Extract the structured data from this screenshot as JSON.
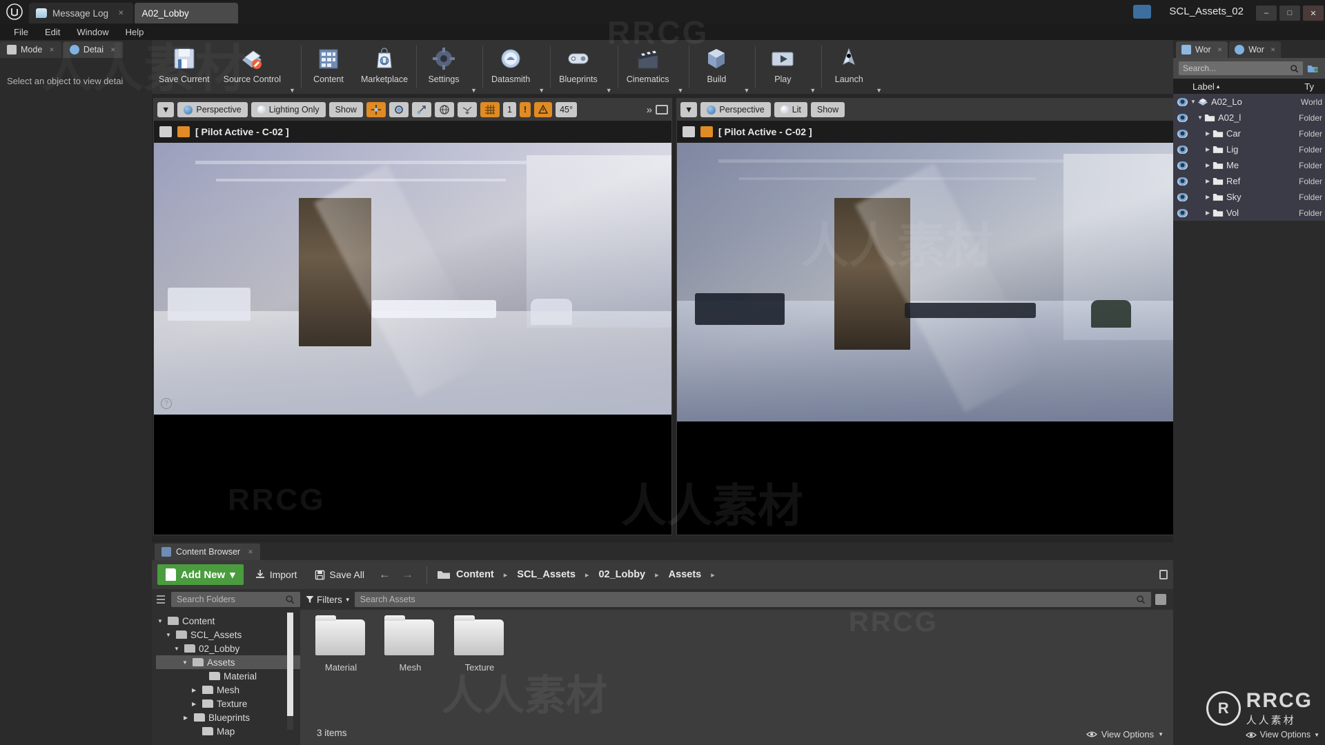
{
  "titlebar": {
    "logo_icon": "unreal-engine-logo",
    "tabs": [
      {
        "label": "Message Log",
        "icon": "message-log-icon",
        "active": false
      },
      {
        "label": "A02_Lobby",
        "icon": "level-icon",
        "active": true
      }
    ],
    "project_name": "SCL_Assets_02",
    "window_buttons": [
      "minimize",
      "maximize",
      "close"
    ],
    "minimize_glyph": "–",
    "maximize_glyph": "□",
    "close_glyph": "✕"
  },
  "menubar": {
    "items": [
      "File",
      "Edit",
      "Window",
      "Help"
    ]
  },
  "left_panel": {
    "tabs": [
      {
        "label": "Mode",
        "icon": "mode-hand-icon",
        "active": false
      },
      {
        "label": "Detai",
        "icon": "details-info-icon",
        "active": true
      }
    ],
    "empty_message": "Select an object to view detai"
  },
  "toolbar": {
    "items": [
      {
        "label": "Save Current",
        "icon": "save-floppy-icon",
        "has_caret": false
      },
      {
        "label": "Source Control",
        "icon": "source-control-icon",
        "has_caret": true
      },
      {
        "label": "Content",
        "icon": "content-browser-icon",
        "has_caret": false
      },
      {
        "label": "Marketplace",
        "icon": "marketplace-bag-icon",
        "has_caret": false
      },
      {
        "label": "Settings",
        "icon": "settings-gear-icon",
        "has_caret": true
      },
      {
        "label": "Datasmith",
        "icon": "datasmith-icon",
        "has_caret": true
      },
      {
        "label": "Blueprints",
        "icon": "blueprints-icon",
        "has_caret": true
      },
      {
        "label": "Cinematics",
        "icon": "cinematics-clapper-icon",
        "has_caret": true
      },
      {
        "label": "Build",
        "icon": "build-cube-icon",
        "has_caret": true
      },
      {
        "label": "Play",
        "icon": "play-icon",
        "has_caret": true
      },
      {
        "label": "Launch",
        "icon": "launch-rocket-icon",
        "has_caret": true
      }
    ]
  },
  "viewports": [
    {
      "name": "viewport-left",
      "camera_label": "Perspective",
      "view_mode": "Lighting Only",
      "show_label": "Show",
      "pilot_text": "[ Pilot Active - C-02 ]",
      "angle_snap": "45°",
      "transform_toggles": [
        "translate-gizmo-icon",
        "rotate-gizmo-icon",
        "scale-gizmo-icon"
      ],
      "coord_icon": "world-coordinate-icon",
      "surface_snap_icon": "surface-snap-icon",
      "grid_snap_icon": "grid-snap-icon",
      "grid_value": "1",
      "overflow_glyph": "»",
      "maximize_icon": "maximize-viewport-icon",
      "help_glyph": "?"
    },
    {
      "name": "viewport-right",
      "camera_label": "Perspective",
      "view_mode": "Lit",
      "show_label": "Show",
      "pilot_text": "[ Pilot Active - C-02 ]",
      "maximize_icon": "maximize-viewport-icon"
    }
  ],
  "content_browser": {
    "tab_label": "Content Browser",
    "tab_icon": "content-browser-icon",
    "add_new_label": "Add New",
    "add_new_caret": "▾",
    "import_label": "Import",
    "save_all_label": "Save All",
    "back_glyph": "←",
    "forward_glyph": "→",
    "breadcrumb": [
      "Content",
      "SCL_Assets",
      "02_Lobby",
      "Assets"
    ],
    "breadcrumb_sep": "▸",
    "folder_search_placeholder": "Search Folders",
    "filters_label": "Filters",
    "asset_search_placeholder": "Search Assets",
    "tree": [
      {
        "label": "Content",
        "depth": 0,
        "expanded": true,
        "selected": false
      },
      {
        "label": "SCL_Assets",
        "depth": 1,
        "expanded": true,
        "selected": false
      },
      {
        "label": "02_Lobby",
        "depth": 2,
        "expanded": true,
        "selected": false
      },
      {
        "label": "Assets",
        "depth": 3,
        "expanded": true,
        "selected": true
      },
      {
        "label": "Material",
        "depth": 4,
        "expanded": false,
        "selected": false
      },
      {
        "label": "Mesh",
        "depth": 4,
        "expanded": false,
        "selected": false
      },
      {
        "label": "Texture",
        "depth": 4,
        "expanded": false,
        "selected": false
      },
      {
        "label": "Blueprints",
        "depth": 3,
        "expanded": false,
        "selected": false
      },
      {
        "label": "Map",
        "depth": 3,
        "expanded": false,
        "selected": false
      }
    ],
    "assets": [
      {
        "name": "Material",
        "type": "folder"
      },
      {
        "name": "Mesh",
        "type": "folder"
      },
      {
        "name": "Texture",
        "type": "folder"
      }
    ],
    "item_count_text": "3 items",
    "view_options_label": "View Options",
    "view_options_icon": "eye-icon"
  },
  "right_panel": {
    "tabs": [
      {
        "label": "Wor",
        "icon": "world-outliner-icon",
        "active": true
      },
      {
        "label": "Wor",
        "icon": "world-settings-icon",
        "active": false
      }
    ],
    "search_placeholder": "Search...",
    "search_icon": "search-icon",
    "new-folder_icon": "new-folder-icon",
    "columns": {
      "label": "Label",
      "type": "Ty",
      "sort_glyph": "▴"
    },
    "rows": [
      {
        "label": "A02_Lo",
        "type": "World",
        "depth": 0,
        "icon": "level-icon",
        "expanded": true
      },
      {
        "label": "A02_l",
        "type": "Folder",
        "depth": 1,
        "icon": "folder-icon",
        "expanded": true
      },
      {
        "label": "Car",
        "type": "Folder",
        "depth": 2,
        "icon": "folder-icon",
        "expanded": false
      },
      {
        "label": "Lig",
        "type": "Folder",
        "depth": 2,
        "icon": "folder-icon",
        "expanded": false
      },
      {
        "label": "Me",
        "type": "Folder",
        "depth": 2,
        "icon": "folder-icon",
        "expanded": false
      },
      {
        "label": "Ref",
        "type": "Folder",
        "depth": 2,
        "icon": "folder-icon",
        "expanded": false
      },
      {
        "label": "Sky",
        "type": "Folder",
        "depth": 2,
        "icon": "folder-icon",
        "expanded": false
      },
      {
        "label": "Vol",
        "type": "Folder",
        "depth": 2,
        "icon": "folder-icon",
        "expanded": false
      }
    ],
    "view_options_label": "View Options",
    "view_options_icon": "eye-icon"
  },
  "watermarks": {
    "brand": "RRCG",
    "cn": "人人素材",
    "logo_text": "RRCG",
    "logo_sub": "人人素材"
  },
  "colors": {
    "accent_orange": "#e08b24",
    "add_new_green": "#4a9c3f",
    "panel_bg": "#2b2b2b",
    "toolbar_bg": "#333333"
  }
}
